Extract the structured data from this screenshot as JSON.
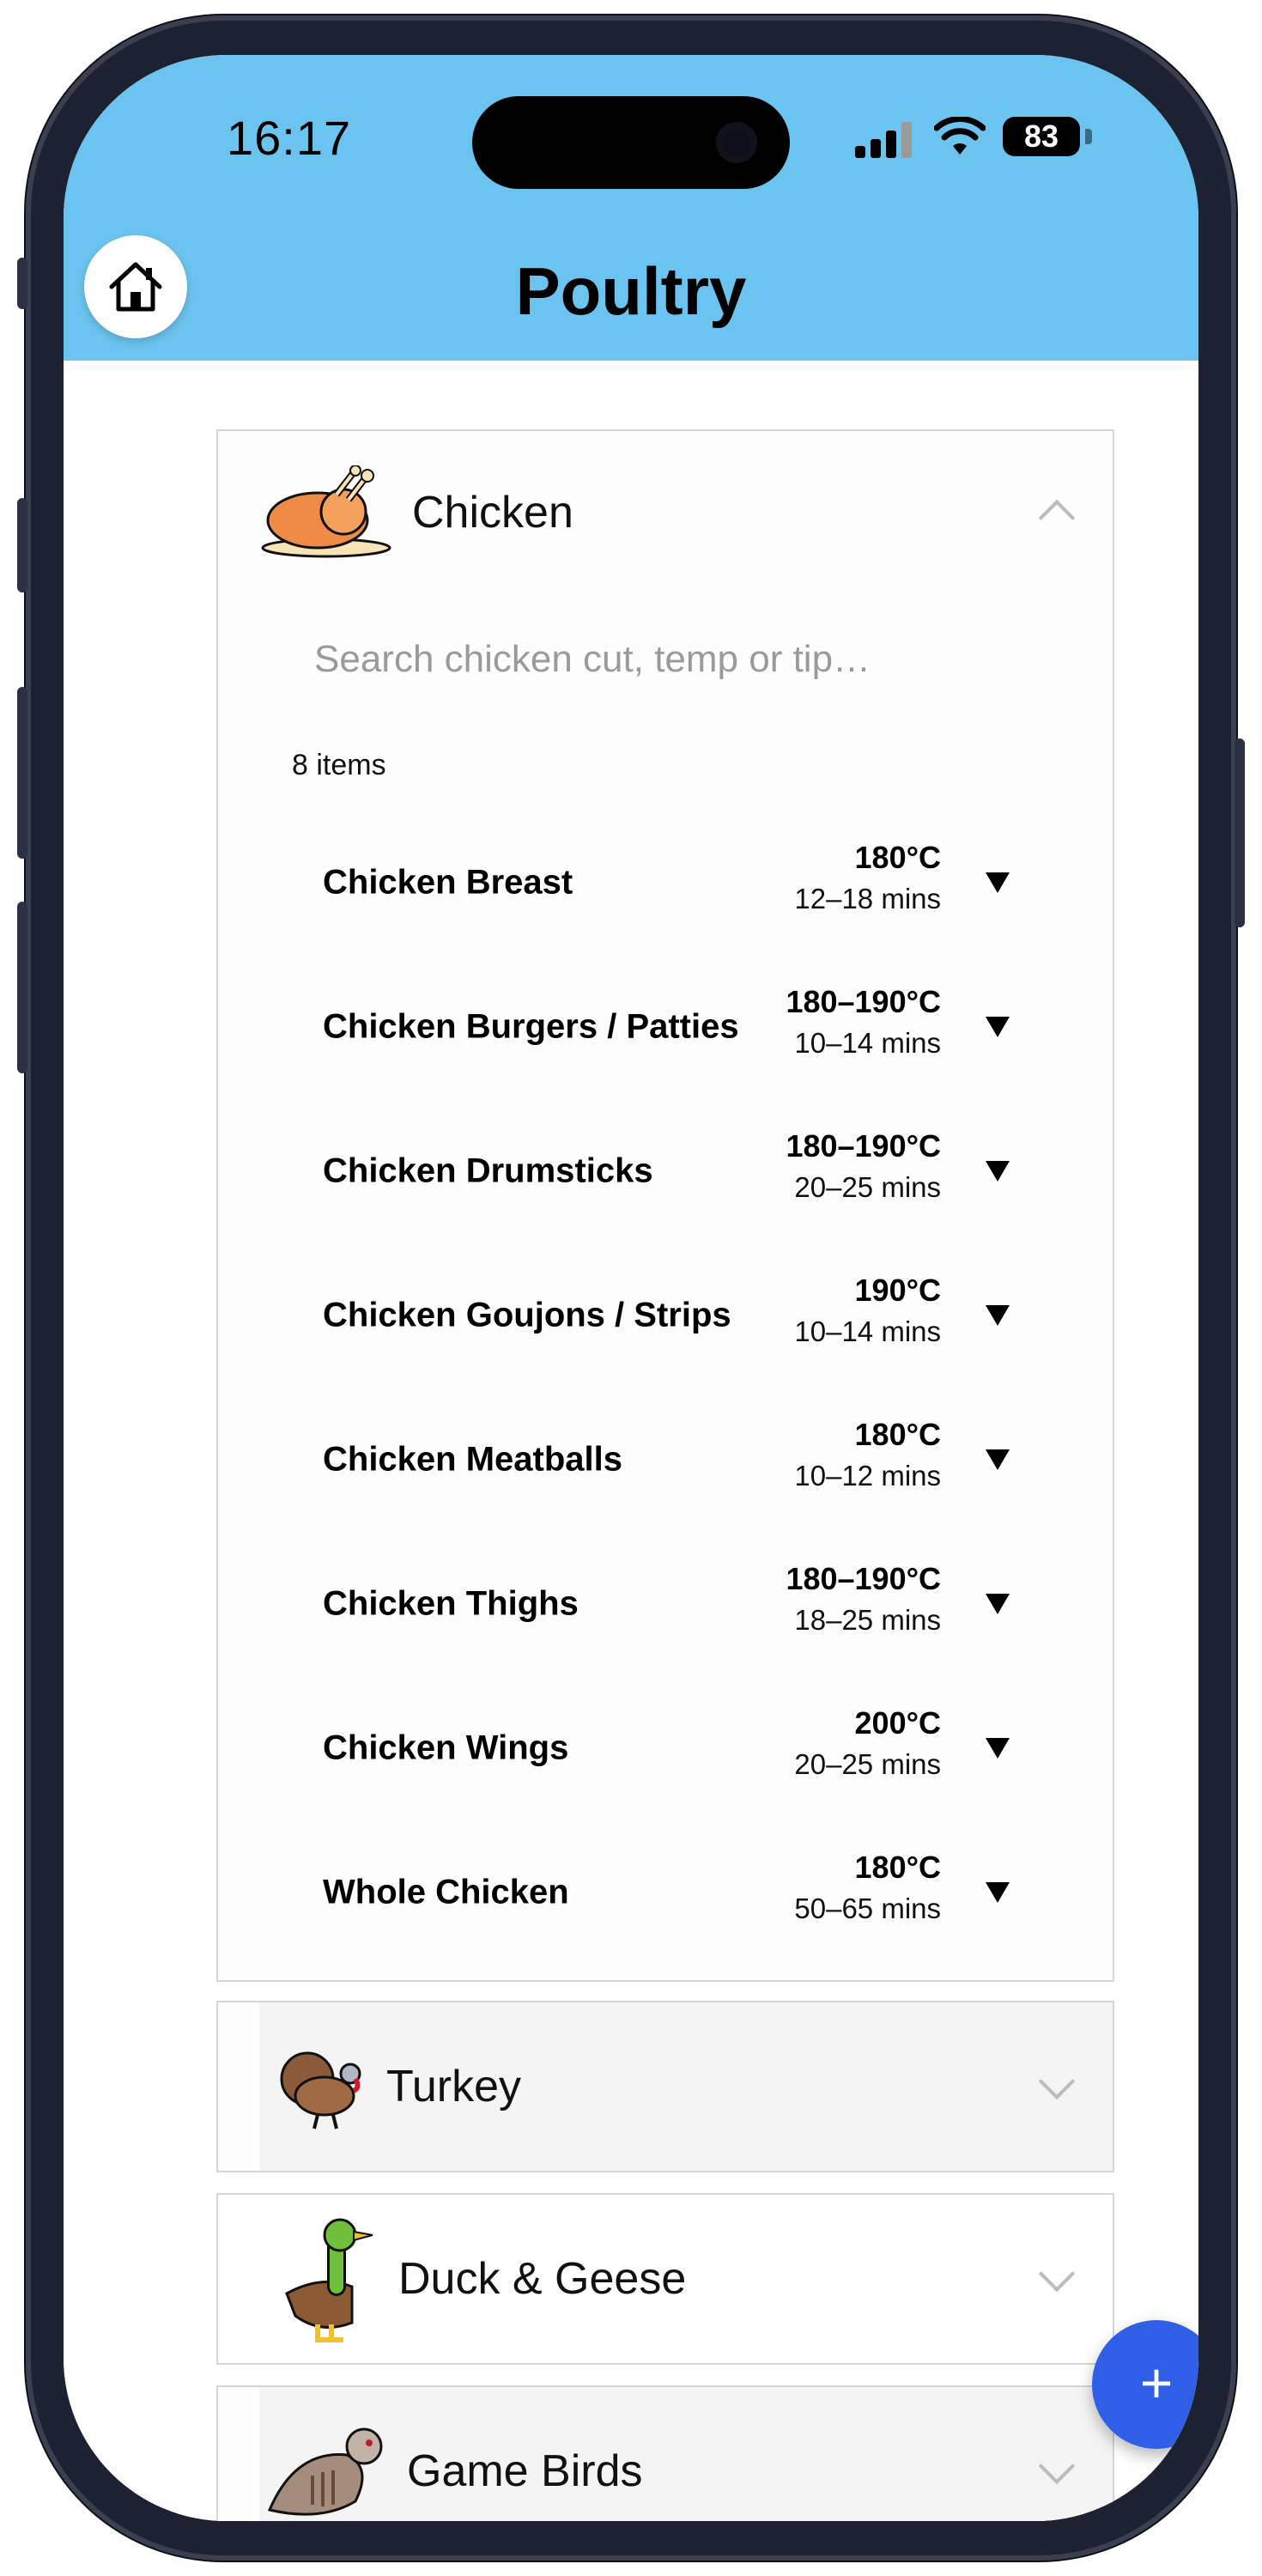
{
  "status_bar": {
    "time": "16:17",
    "battery": "83"
  },
  "header": {
    "title": "Poultry"
  },
  "chicken": {
    "title": "Chicken",
    "search_placeholder": "Search chicken cut, temp or tip…",
    "count": "8 items",
    "items": [
      {
        "name": "Chicken Breast",
        "temp": "180°C",
        "time": "12–18 mins"
      },
      {
        "name": "Chicken Burgers / Patties",
        "temp": "180–190°C",
        "time": "10–14 mins"
      },
      {
        "name": "Chicken Drumsticks",
        "temp": "180–190°C",
        "time": "20–25 mins"
      },
      {
        "name": "Chicken Goujons / Strips",
        "temp": "190°C",
        "time": "10–14 mins"
      },
      {
        "name": "Chicken Meatballs",
        "temp": "180°C",
        "time": "10–12 mins"
      },
      {
        "name": "Chicken Thighs",
        "temp": "180–190°C",
        "time": "18–25 mins"
      },
      {
        "name": "Chicken Wings",
        "temp": "200°C",
        "time": "20–25 mins"
      },
      {
        "name": "Whole Chicken",
        "temp": "180°C",
        "time": "50–65 mins"
      }
    ]
  },
  "sections": [
    {
      "title": "Turkey",
      "icon": "turkey-icon"
    },
    {
      "title": "Duck & Geese",
      "icon": "duck-icon"
    },
    {
      "title": "Game Birds",
      "icon": "partridge-icon"
    }
  ],
  "fab": {
    "label": "+"
  },
  "colors": {
    "header": "#6bc4ef",
    "fab": "#2e5fe6"
  }
}
